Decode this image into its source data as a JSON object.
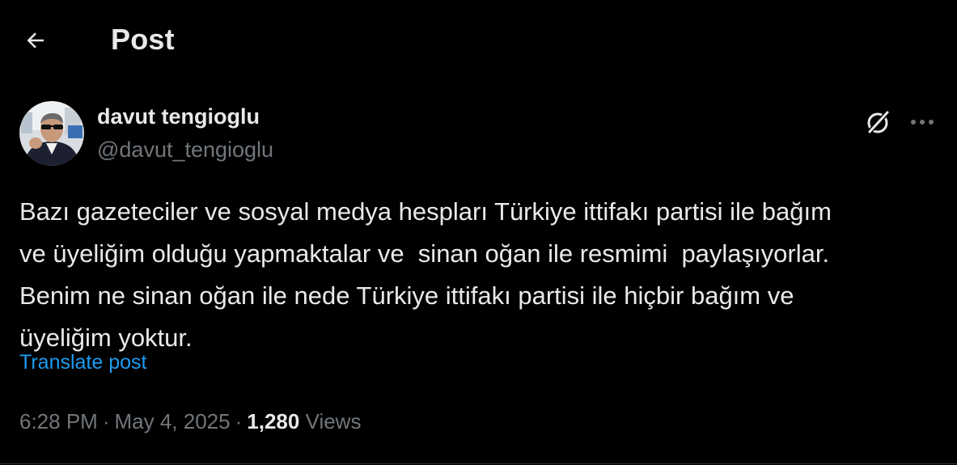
{
  "header": {
    "title": "Post"
  },
  "author": {
    "display_name": "davut tengioglu",
    "handle": "@davut_tengioglu"
  },
  "post": {
    "text": "Bazı gazeteciler ve sosyal medya hespları Türkiye ittifakı partisi ile bağım\nve üyeliğim olduğu yapmaktalar ve  sinan oğan ile resmimi  paylaşıyorlar.\nBenim ne sinan oğan ile nede Türkiye ittifakı partisi ile hiçbir bağım ve\nüyeliğim yoktur.",
    "translate_label": "Translate post",
    "time": "6:28 PM",
    "date": "May 4, 2025",
    "separator": "·",
    "views_count": "1,280",
    "views_label": "Views"
  },
  "icons": {
    "back": "arrow-left-icon",
    "grok": "grok-icon",
    "more": "more-horizontal-icon"
  },
  "colors": {
    "background": "#000000",
    "primary_text": "#e7e9ea",
    "secondary_text": "#71767b",
    "link": "#1d9bf0"
  }
}
